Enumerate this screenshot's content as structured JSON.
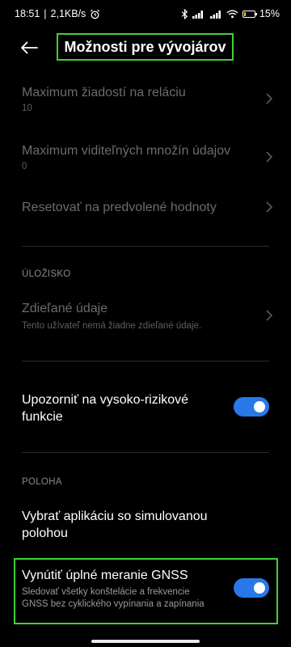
{
  "status_bar": {
    "time": "18:51",
    "speed": "2,1KB/s",
    "battery": "15"
  },
  "header": {
    "title": "Možnosti pre vývojárov",
    "back_icon": "arrow-left-icon"
  },
  "rows": {
    "max_requests": {
      "title": "Maximum žiadostí na reláciu",
      "value": "10"
    },
    "max_datasets": {
      "title": "Maximum viditeľných množín údajov",
      "value": "0"
    },
    "reset": {
      "title": "Resetovať na predvolené hodnoty"
    }
  },
  "storage": {
    "section_label": "ÚLOŽISKO",
    "shared_data_title": "Zdieľané údaje",
    "shared_data_sub": "Tento užívateľ nemá žiadne zdieľané údaje."
  },
  "risky": {
    "line1": "Upozorniť na vysoko-rizikové",
    "line2": "funkcie",
    "enabled": true
  },
  "location": {
    "section_label": "POLOHA",
    "mock_line1": "Vybrať aplikáciu so simulovanou",
    "mock_line2": "polohou",
    "gnss_title": "Vynútiť úplné meranie GNSS",
    "gnss_sub1": "Sledovať všetky konštelácie a frekvencie",
    "gnss_sub2": "GNSS bez cyklického vypínania a zapínania",
    "gnss_enabled": true
  },
  "colors": {
    "highlight": "#3fd13a",
    "toggle_on": "#2878e8",
    "background": "#000000"
  }
}
